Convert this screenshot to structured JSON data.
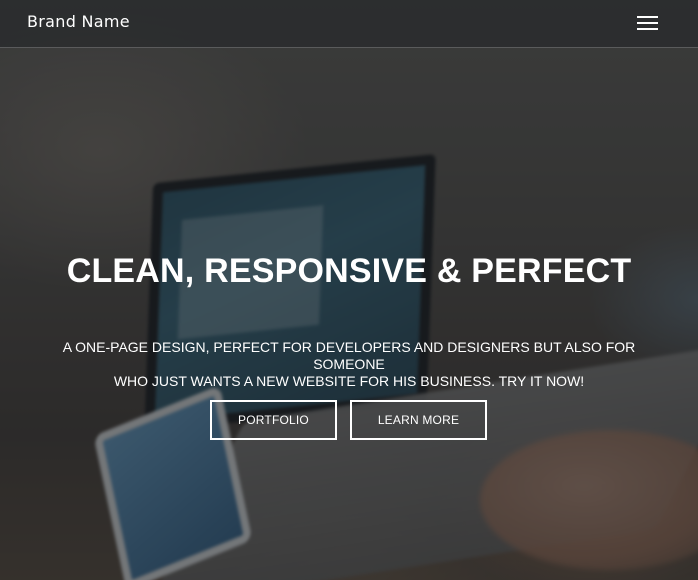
{
  "navbar": {
    "brand": "Brand Name",
    "menu_icon": "hamburger-menu-icon"
  },
  "hero": {
    "title": "CLEAN, RESPONSIVE & PERFECT",
    "subtitle_line1": "A ONE-PAGE DESIGN, PERFECT FOR DEVELOPERS AND DESIGNERS BUT ALSO FOR SOMEONE",
    "subtitle_line2": "WHO JUST WANTS A NEW WEBSITE FOR HIS BUSINESS. TRY IT NOW!",
    "buttons": {
      "portfolio": "PORTFOLIO",
      "learn_more": "LEARN MORE"
    }
  },
  "colors": {
    "text": "#ffffff",
    "overlay": "#141618",
    "button_border": "#ffffff"
  }
}
